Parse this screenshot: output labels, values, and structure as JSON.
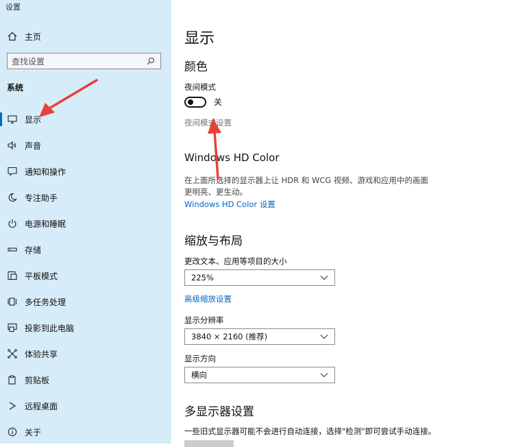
{
  "window": {
    "title": "设置"
  },
  "sidebar": {
    "home_label": "主页",
    "search_placeholder": "查找设置",
    "section_title": "系统",
    "items": [
      {
        "label": "显示",
        "icon": "monitor-icon",
        "selected": true
      },
      {
        "label": "声音",
        "icon": "speaker-icon"
      },
      {
        "label": "通知和操作",
        "icon": "notification-icon"
      },
      {
        "label": "专注助手",
        "icon": "moon-icon"
      },
      {
        "label": "电源和睡眠",
        "icon": "power-icon"
      },
      {
        "label": "存储",
        "icon": "storage-icon"
      },
      {
        "label": "平板模式",
        "icon": "tablet-icon"
      },
      {
        "label": "多任务处理",
        "icon": "multitask-icon"
      },
      {
        "label": "投影到此电脑",
        "icon": "project-icon"
      },
      {
        "label": "体验共享",
        "icon": "share-icon"
      },
      {
        "label": "剪贴板",
        "icon": "clipboard-icon"
      },
      {
        "label": "远程桌面",
        "icon": "remote-desktop-icon"
      },
      {
        "label": "关于",
        "icon": "info-icon"
      }
    ]
  },
  "main": {
    "page_title": "显示",
    "color": {
      "title": "颜色",
      "night_mode_label": "夜间模式",
      "toggle_state": "关",
      "night_mode_settings": "夜间模式设置"
    },
    "hdr": {
      "title": "Windows HD Color",
      "description": "在上面所选择的显示器上让 HDR 和 WCG 视频、游戏和应用中的画面更明亮、更生动。",
      "link": "Windows HD Color 设置"
    },
    "scale": {
      "title": "缩放与布局",
      "size_label": "更改文本、应用等项目的大小",
      "size_value": "225%",
      "advanced_link": "高级缩放设置",
      "resolution_label": "显示分辨率",
      "resolution_value": "3840 × 2160 (推荐)",
      "orientation_label": "显示方向",
      "orientation_value": "横向"
    },
    "multi": {
      "title": "多显示器设置",
      "description": "一些旧式显示器可能不会进行自动连接，选择\"检测\"即可尝试手动连接。"
    }
  },
  "colors": {
    "sidebar_bg": "#d6ecf8",
    "accent": "#0067c0",
    "annotation_arrow": "#e8403a"
  }
}
